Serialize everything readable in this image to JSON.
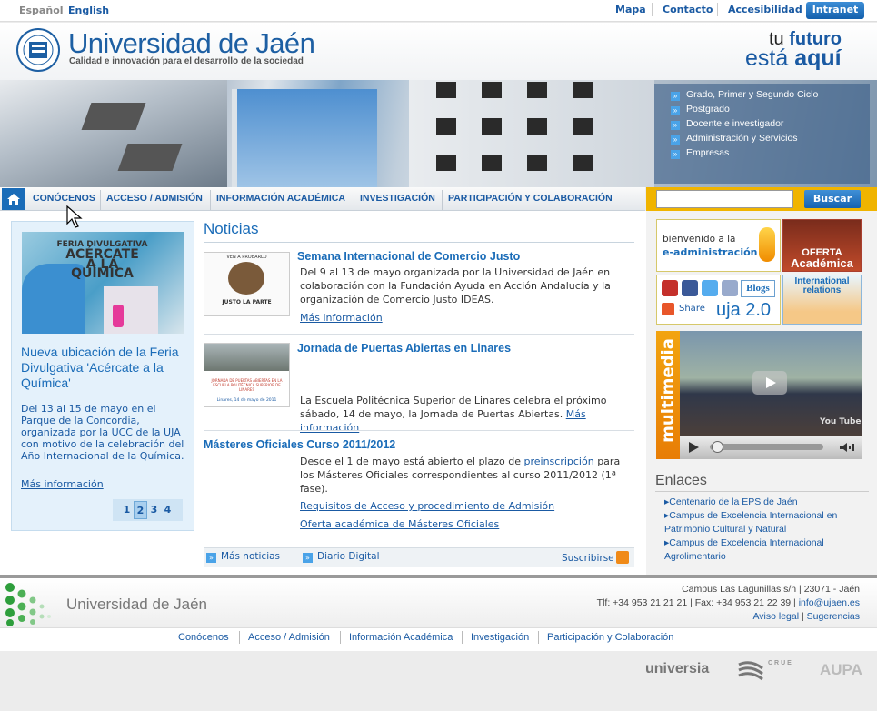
{
  "topbar": {
    "lang_es": "Español",
    "lang_en": "English",
    "links": [
      "Mapa",
      "Contacto",
      "Accesibilidad"
    ],
    "intranet": "Intranet"
  },
  "header": {
    "title": "Universidad de Jaén",
    "subtitle": "Calidad e innovación para el desarrollo de la sociedad",
    "slogan_1a": "tu ",
    "slogan_1b": "futuro",
    "slogan_2a": "está ",
    "slogan_2b": "aquí"
  },
  "banner_menu": [
    "Grado, Primer y Segundo Ciclo",
    "Postgrado",
    "Docente e investigador",
    "Administración y Servicios",
    "Empresas"
  ],
  "nav": {
    "items": [
      "CONÓCENOS",
      "ACCESO / ADMISIÓN",
      "INFORMACIÓN ACADÉMICA",
      "INVESTIGACIÓN",
      "PARTICIPACIÓN Y COLABORACIÓN"
    ],
    "search_button": "Buscar"
  },
  "featured": {
    "image_tag_1": "FERIA DIVULGATIVA",
    "image_tag_2": "ACÉRCATE",
    "image_tag_3": "A LA QUÍMICA",
    "title": "Nueva ubicación de la Feria Divulgativa 'Acércate a la Química'",
    "text": "Del 13 al 15 de mayo en el Parque de la Concordia, organizada por la UCC de la UJA con motivo de la celebración del Año Internacional de la Química.",
    "more": "Más información",
    "pages": [
      "1",
      "2",
      "3",
      "4"
    ]
  },
  "news": {
    "heading": "Noticias",
    "items": [
      {
        "title": "Semana Internacional de Comercio Justo",
        "text": "Del 9 al 13 de mayo organizada por la Universidad de Jaén en colaboración con la Fundación Ayuda en Acción Andalucía y la organización de Comercio Justo IDEAS.",
        "link": "Más información",
        "thumb_text_top": "VEN A PROBARLO",
        "thumb_text_bottom": "JUSTO LA PARTE"
      },
      {
        "title": "Jornada de Puertas Abiertas en Linares",
        "text": "La Escuela Politécnica Superior de Linares celebra el próximo sábado, 14 de mayo, la Jornada de Puertas Abiertas.",
        "link": "Más información",
        "thumb_caption": "JORNADA DE PUERTAS ABIERTAS EN LA ESCUELA POLITÉCNICA SUPERIOR DE LINARES",
        "thumb_date": "Linares, 14 de mayo de 2011"
      },
      {
        "title": "Másteres Oficiales Curso 2011/2012",
        "text_a": "Desde el 1 de mayo está abierto el plazo de ",
        "text_link": "preinscripción",
        "text_b": " para los Másteres Oficiales correspondientes al curso 2011/2012 (1ª fase).",
        "link_1": "Requisitos de Acceso y procedimiento de Admisión",
        "link_2": "Oferta académica de Másteres Oficiales"
      }
    ],
    "footer_more": "Más noticias",
    "footer_diario": "Diario Digital",
    "footer_subscribe": "Suscribirse"
  },
  "widgets": {
    "eadmin_1": "bienvenido a la",
    "eadmin_2": "e-administración",
    "oferta_1": "OFERTA",
    "oferta_2": "Académica",
    "blogs": "Blogs",
    "share": "Share",
    "uja20": "uja 2.0",
    "intl_1": "International",
    "intl_2": "relations",
    "multimedia": "multimedia",
    "youtube": "You Tube"
  },
  "enlaces": {
    "heading": "Enlaces",
    "items": [
      "Centenario de la EPS de Jaén",
      "Campus de Excelencia Internacional en Patrimonio Cultural y Natural",
      "Campus de Excelencia Internacional Agrolimentario"
    ]
  },
  "footer": {
    "name": "Universidad de Jaén",
    "address": "Campus Las Lagunillas s/n | 23071 - Jaén",
    "phone": "Tlf: +34 953 21 21 21 | Fax: +34 953 21 22 39 | ",
    "email": "info@ujaen.es",
    "legal": "Aviso legal",
    "suggest": "Sugerencias",
    "links": [
      "Conócenos",
      "Acceso / Admisión",
      "Información Académica",
      "Investigación",
      "Participación y Colaboración"
    ],
    "partners": [
      "universia",
      "CRUE",
      "AUPA"
    ]
  },
  "colors": {
    "brand_blue": "#1a5aa3",
    "accent_orange": "#f0b400"
  }
}
